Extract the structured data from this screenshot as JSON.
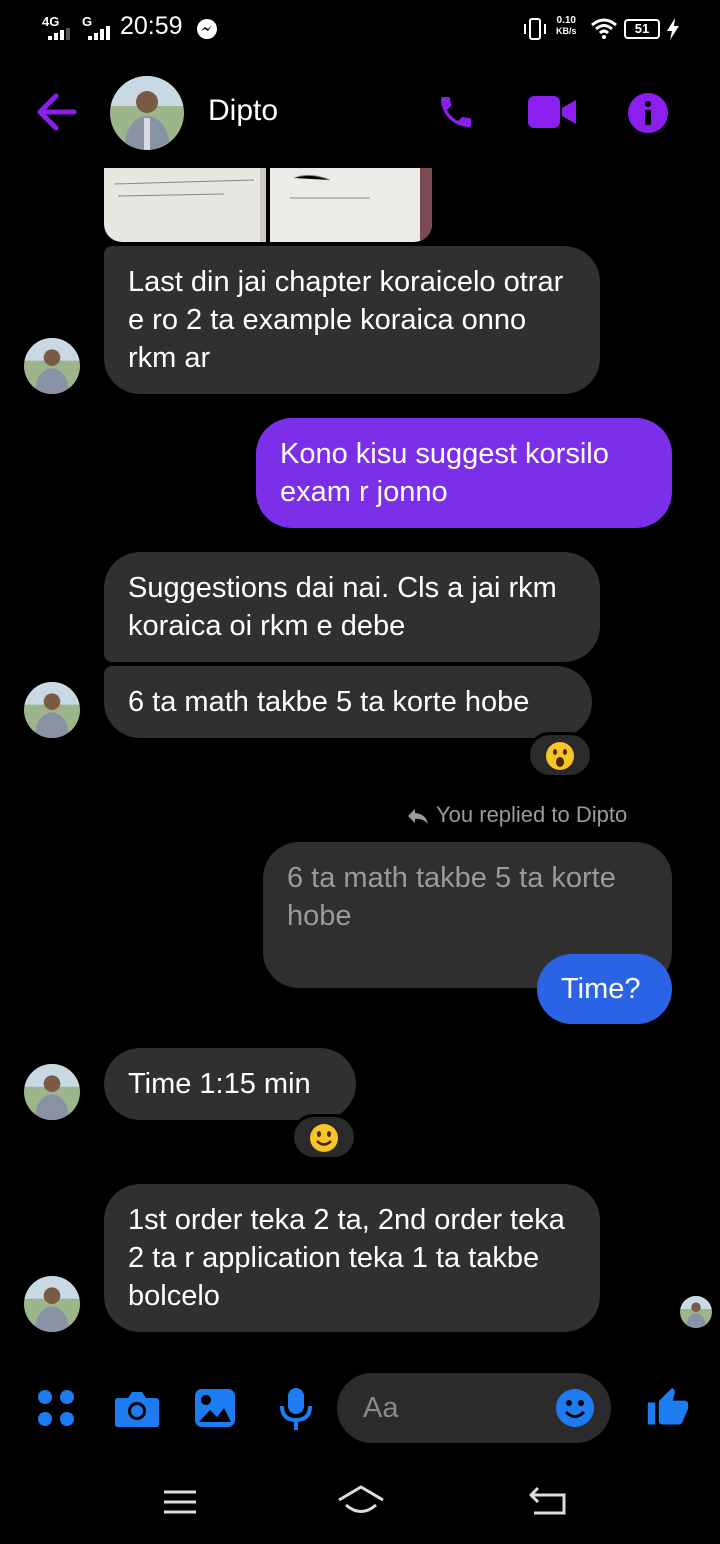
{
  "status_bar": {
    "net1": "4G",
    "net2": "G",
    "time": "20:59",
    "speed_value": "0.10",
    "speed_unit": "KB/s",
    "battery": "51"
  },
  "header": {
    "contact_name": "Dipto",
    "icons": [
      "back-arrow-icon",
      "phone-icon",
      "video-icon",
      "info-icon"
    ],
    "accent_color": "#8b1ff0"
  },
  "messages": [
    {
      "sender": "them",
      "text": "Last din jai chapter koraicelo otrar e ro 2 ta example koraica onno rkm ar"
    },
    {
      "sender": "me",
      "text": "Kono kisu suggest korsilo exam r jonno"
    },
    {
      "sender": "them",
      "text": "Suggestions dai nai. Cls a jai rkm koraica oi rkm e debe"
    },
    {
      "sender": "them",
      "text": "6 ta math takbe 5 ta korte hobe",
      "reaction": "😮"
    },
    {
      "sender": "me",
      "reply_note": "You replied to Dipto",
      "quoted": "6 ta math takbe 5 ta korte hobe",
      "text": "Time?"
    },
    {
      "sender": "them",
      "text": "Time 1:15 min",
      "reaction": "🙂"
    },
    {
      "sender": "them",
      "text": "1st order teka 2 ta, 2nd order teka 2 ta r application teka 1 ta takbe bolcelo"
    }
  ],
  "composer": {
    "placeholder": "Aa",
    "icons": [
      "menu-dots-icon",
      "camera-icon",
      "gallery-icon",
      "mic-icon",
      "emoji-icon",
      "thumbs-up-icon"
    ],
    "accent_color": "#1e7cf2"
  },
  "nav_bar": {
    "icons": [
      "recent-apps-icon",
      "home-icon",
      "back-icon"
    ]
  }
}
